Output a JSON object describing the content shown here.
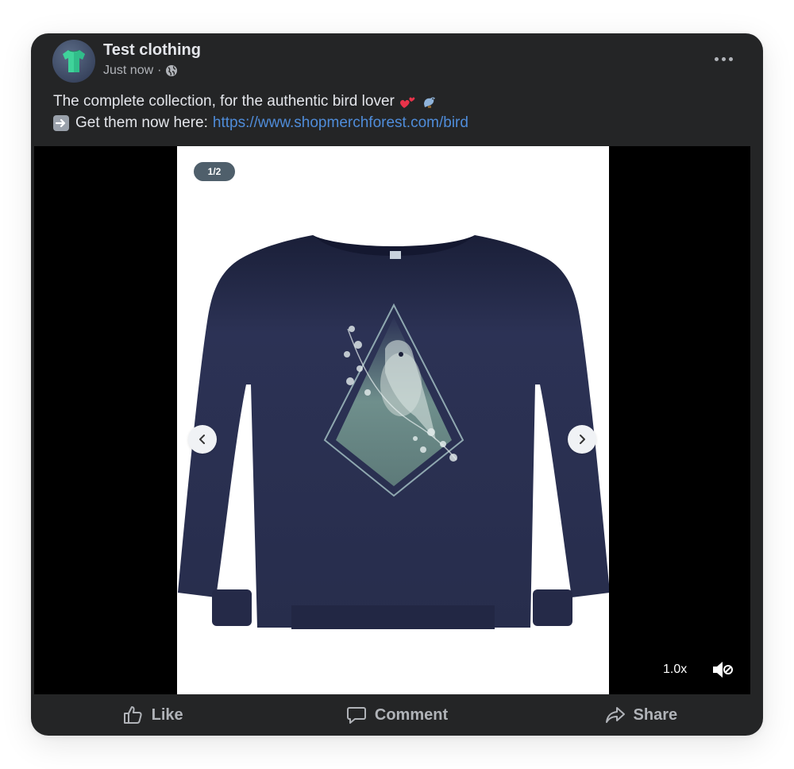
{
  "post": {
    "page_name": "Test clothing",
    "timestamp": "Just now",
    "separator": "·",
    "privacy_icon": "globe-icon",
    "more_icon": "more-horizontal-icon",
    "avatar_icon": "tshirt-icon",
    "text_line1": "The complete collection, for the authentic bird lover",
    "text_line1_emojis": [
      "two-hearts-emoji",
      "bird-emoji"
    ],
    "text_line2_prefix_icon": "right-arrow-emoji",
    "text_line2": "Get them now here:",
    "link": "https://www.shopmerchforest.com/bird"
  },
  "media": {
    "counter": "1/2",
    "prev_icon": "chevron-left-icon",
    "next_icon": "chevron-right-icon",
    "playback_speed": "1.0x",
    "mute_icon": "volume-muted-icon",
    "product": "navy-sweatshirt-with-bird-print"
  },
  "actions": {
    "like_label": "Like",
    "comment_label": "Comment",
    "share_label": "Share",
    "like_icon": "thumbs-up-icon",
    "comment_icon": "comment-icon",
    "share_icon": "share-arrow-icon"
  },
  "colors": {
    "card_bg": "#242526",
    "text_primary": "#e4e6eb",
    "text_secondary": "#b0b3b8",
    "link": "#4f8cd9",
    "sweatshirt": "#2b3152",
    "print_accent": "#6f8f8c"
  }
}
